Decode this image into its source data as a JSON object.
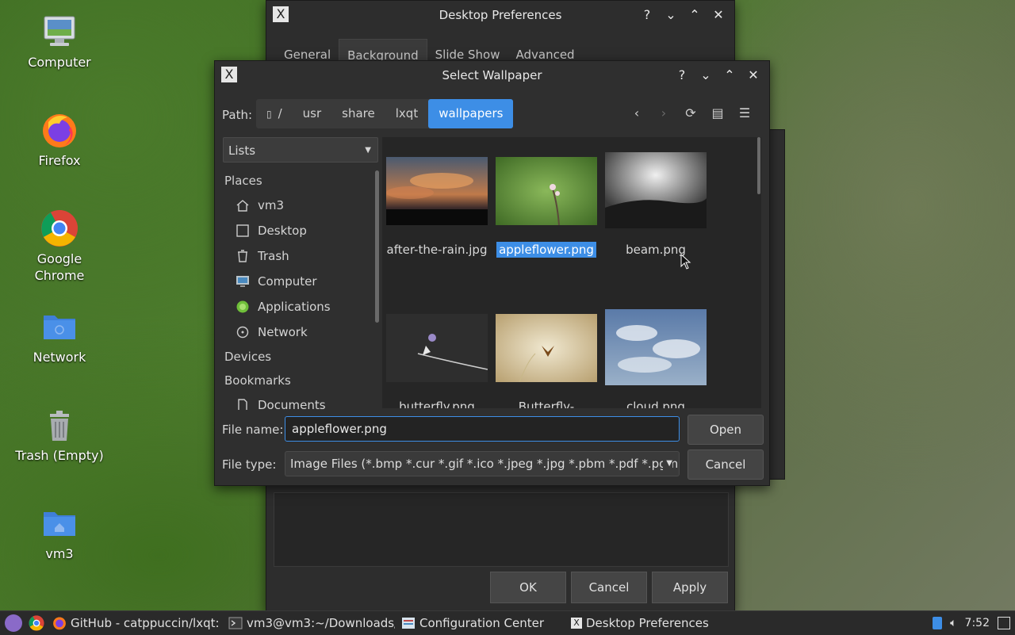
{
  "desktop": {
    "icons": [
      {
        "label": "Computer"
      },
      {
        "label": "Firefox"
      },
      {
        "label": "Google Chrome"
      },
      {
        "label": "Network"
      },
      {
        "label": "Trash (Empty)"
      },
      {
        "label": "vm3"
      }
    ]
  },
  "prefs_window": {
    "title": "Desktop Preferences",
    "tabs": [
      "General",
      "Background",
      "Slide Show",
      "Advanced"
    ],
    "active_tab": "Background",
    "buttons": {
      "ok": "OK",
      "cancel": "Cancel",
      "apply": "Apply"
    }
  },
  "dialog": {
    "title": "Select Wallpaper",
    "path_label": "Path:",
    "crumbs": [
      "/",
      "usr",
      "share",
      "lxqt",
      "wallpapers"
    ],
    "active_crumb": "wallpapers",
    "view_combo": "Lists",
    "sidebar": {
      "places_header": "Places",
      "places": [
        "vm3",
        "Desktop",
        "Trash",
        "Computer",
        "Applications",
        "Network"
      ],
      "devices_header": "Devices",
      "bookmarks_header": "Bookmarks",
      "bookmarks": [
        "Documents"
      ]
    },
    "files": [
      {
        "name": "after-the-rain.jpg",
        "selected": false
      },
      {
        "name": "appleflower.png",
        "selected": true
      },
      {
        "name": "beam.png",
        "selected": false
      },
      {
        "name": "butterfly.png",
        "selected": false
      },
      {
        "name": "Butterfly-",
        "selected": false
      },
      {
        "name": "cloud.png",
        "selected": false
      }
    ],
    "file_name_label": "File name:",
    "file_name_value": "appleflower.png",
    "file_type_label": "File type:",
    "file_type_value": "Image Files (*.bmp *.cur *.gif *.ico *.jpeg *.jpg *.pbm *.pdf *.pgm",
    "open_label": "Open",
    "cancel_label": "Cancel"
  },
  "taskbar": {
    "tasks": [
      {
        "label": "GitHub - catppuccin/lxqt:..."
      },
      {
        "label": "vm3@vm3:~/Downloads/..."
      },
      {
        "label": "Configuration Center"
      },
      {
        "label": "Desktop Preferences"
      }
    ],
    "clock": "7:52"
  },
  "colors": {
    "accent": "#3d8ee6",
    "window_bg": "#2f2f2f"
  }
}
